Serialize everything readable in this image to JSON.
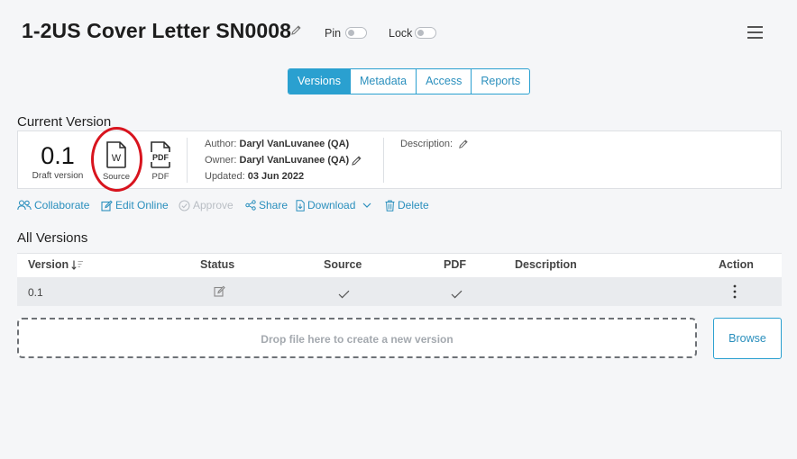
{
  "header": {
    "title": "1-2US Cover Letter SN0008",
    "pin_label": "Pin",
    "lock_label": "Lock"
  },
  "tabs": [
    {
      "label": "Versions",
      "active": true
    },
    {
      "label": "Metadata",
      "active": false
    },
    {
      "label": "Access",
      "active": false
    },
    {
      "label": "Reports",
      "active": false
    }
  ],
  "current_version": {
    "section_title": "Current Version",
    "number": "0.1",
    "status": "Draft version",
    "source_label": "Source",
    "source_icon_letter": "W",
    "pdf_label": "PDF",
    "pdf_icon_text": "PDF",
    "author_label": "Author:",
    "author": "Daryl VanLuvanee (QA)",
    "owner_label": "Owner:",
    "owner": "Daryl VanLuvanee (QA)",
    "updated_label": "Updated:",
    "updated": "03 Jun 2022",
    "description_label": "Description:"
  },
  "actions": [
    {
      "label": "Collaborate",
      "icon": "users-icon",
      "enabled": true
    },
    {
      "label": "Edit Online",
      "icon": "edit-icon",
      "enabled": true
    },
    {
      "label": "Approve",
      "icon": "check-circle-icon",
      "enabled": false
    },
    {
      "label": "Share",
      "icon": "share-icon",
      "enabled": true
    },
    {
      "label": "Download",
      "icon": "download-file-icon",
      "enabled": true
    },
    {
      "label": "Delete",
      "icon": "trash-icon",
      "enabled": true
    }
  ],
  "all_versions": {
    "section_title": "All Versions",
    "columns": [
      "Version",
      "Status",
      "Source",
      "PDF",
      "Description",
      "Action"
    ],
    "rows": [
      {
        "version": "0.1",
        "status_icon": "edit-icon",
        "source_icon": "check-icon",
        "pdf_icon": "check-icon",
        "description": "",
        "action_icon": "kebab-menu-icon"
      }
    ]
  },
  "dropzone": {
    "text": "Drop file here to create a new version",
    "browse_label": "Browse"
  },
  "colors": {
    "accent": "#2aa0d0",
    "highlight_ring": "#d8141e",
    "background": "#f5f6f8"
  }
}
